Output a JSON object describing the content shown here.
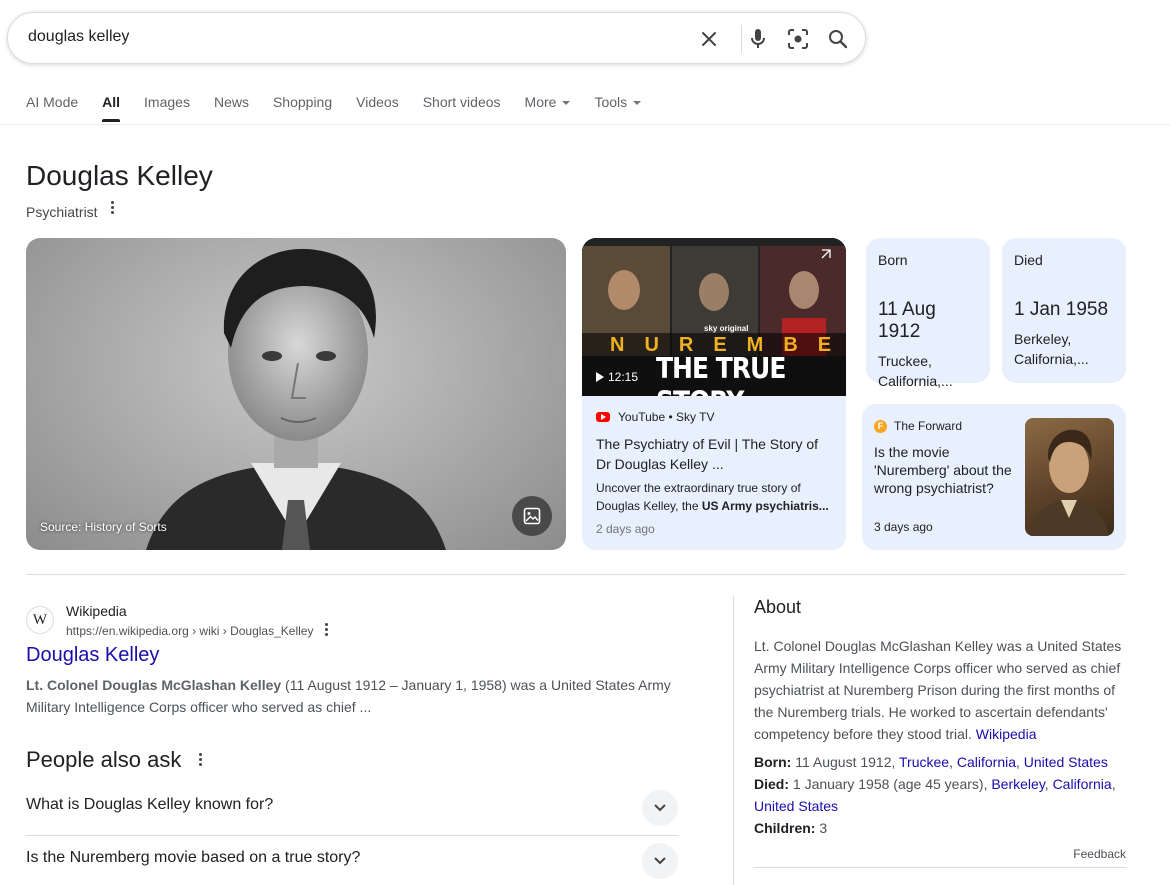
{
  "search": {
    "query": "douglas kelley"
  },
  "tabs": [
    {
      "label": "AI Mode"
    },
    {
      "label": "All"
    },
    {
      "label": "Images"
    },
    {
      "label": "News"
    },
    {
      "label": "Shopping"
    },
    {
      "label": "Videos"
    },
    {
      "label": "Short videos"
    },
    {
      "label": "More"
    },
    {
      "label": "Tools"
    }
  ],
  "entity": {
    "title": "Douglas Kelley",
    "subtitle": "Psychiatrist"
  },
  "main_image": {
    "source": "Source: History of Sorts"
  },
  "video": {
    "duration": "12:15",
    "source": "YouTube • Sky TV",
    "thumb_brand": "sky original",
    "thumb_line1": "NUREMBERG",
    "thumb_line2": "THE TRUE STORY",
    "title": "The Psychiatry of Evil | The Story of Dr Douglas Kelley ...",
    "desc_plain": "Uncover the extraordinary true story of Douglas Kelley, the ",
    "desc_bold": "US Army psychiatris...",
    "time": "2 days ago"
  },
  "born": {
    "label": "Born",
    "date": "11 Aug 1912",
    "place": "Truckee, California,..."
  },
  "died": {
    "label": "Died",
    "date": "1 Jan 1958",
    "place": "Berkeley, California,..."
  },
  "article": {
    "source": "The Forward",
    "title": "Is the movie 'Nuremberg' about the wrong psychiatrist?",
    "time": "3 days ago"
  },
  "wiki": {
    "name": "Wikipedia",
    "url": "https://en.wikipedia.org › wiki › Douglas_Kelley",
    "link": "Douglas Kelley",
    "snippet_bold": "Lt. Colonel Douglas McGlashan Kelley",
    "snippet_rest": " (11 August 1912 – January 1, 1958) was a United States Army Military Intelligence Corps officer who served as chief ..."
  },
  "paa": {
    "title": "People also ask",
    "questions": [
      "What is Douglas Kelley known for?",
      "Is the Nuremberg movie based on a true story?"
    ]
  },
  "about": {
    "heading": "About",
    "text": "Lt. Colonel Douglas McGlashan Kelley was a United States Army Military Intelligence Corps officer who served as chief psychiatrist at Nuremberg Prison during the first months of the Nuremberg trials. He worked to ascertain defendants' competency before they stood trial. ",
    "text_link": "Wikipedia",
    "born_label": "Born:",
    "born_plain": " 11 August 1912, ",
    "born_links": [
      "Truckee",
      "California",
      "United States"
    ],
    "died_label": "Died:",
    "died_plain": " 1 January 1958 (age 45 years), ",
    "died_links": [
      "Berkeley",
      "California",
      "United States"
    ],
    "children_label": "Children:",
    "children_value": " 3",
    "feedback": "Feedback"
  },
  "colors": {
    "link": "#1a0dab",
    "card_bg": "#e8f0fe"
  }
}
